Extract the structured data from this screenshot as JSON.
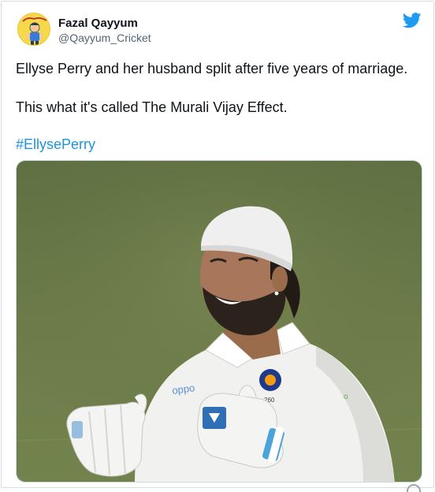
{
  "tweet": {
    "author": {
      "name": "Fazal Qayyum",
      "handle": "@Qayyum_Cricket",
      "avatar_icon": "cartoon-cricketer-avatar"
    },
    "platform_icon": "twitter-bird-icon",
    "lines": [
      "Ellyse Perry and her husband split after five years of marriage.",
      "This what it's called The Murali Vijay Effect."
    ],
    "hashtag": "#EllysePerry",
    "media": {
      "type": "photo",
      "jersey_text": "oppo",
      "jersey_number": "260"
    }
  },
  "colors": {
    "link": "#1b95e0",
    "twitter_blue": "#1d9bf0",
    "field_green": "#6a7a45",
    "handle_gray": "#536471"
  }
}
